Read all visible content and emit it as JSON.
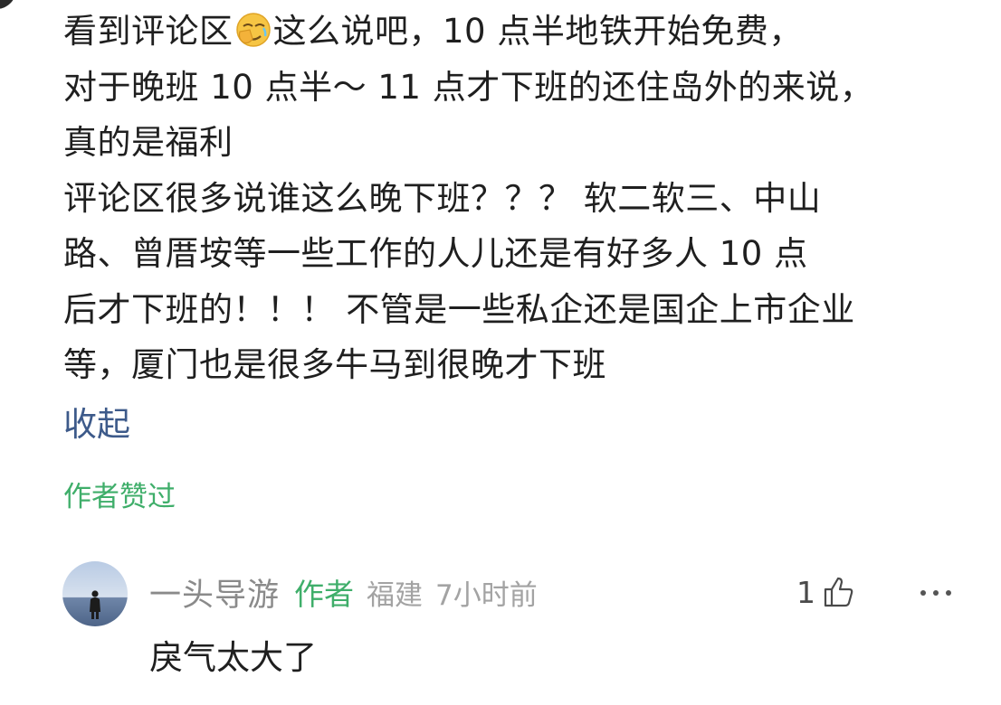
{
  "comment": {
    "lines": [
      {
        "before": "看到评论区",
        "emoji": "face-palm-emoji",
        "after": "这么说吧，10 点半地铁开始免费，"
      },
      {
        "text": "对于晚班 10 点半～ 11 点才下班的还住岛外的来说，"
      },
      {
        "text": "真的是福利"
      },
      {
        "text": "评论区很多说谁这么晚下班？？？ 软二软三、中山"
      },
      {
        "text": "路、曾厝垵等一些工作的人儿还是有好多人 10 点"
      },
      {
        "text": "后才下班的！！！ 不管是一些私企还是国企上市企业"
      },
      {
        "text": "等，厦门也是很多牛马到很晚才下班"
      }
    ],
    "collapse_label": "收起",
    "author_liked_label": "作者赞过"
  },
  "reply": {
    "avatar_icon": "user-avatar",
    "name": "一头导游",
    "badge": "作者",
    "location": "福建",
    "time": "7小时前",
    "like_count": "1",
    "like_icon": "thumbs-up-icon",
    "more_icon": "more-dots-icon",
    "text": "戾气太大了"
  },
  "colors": {
    "text": "#1f1f1f",
    "link": "#3d5a8a",
    "green": "#3fae6a",
    "meta": "#a3a3a3"
  }
}
